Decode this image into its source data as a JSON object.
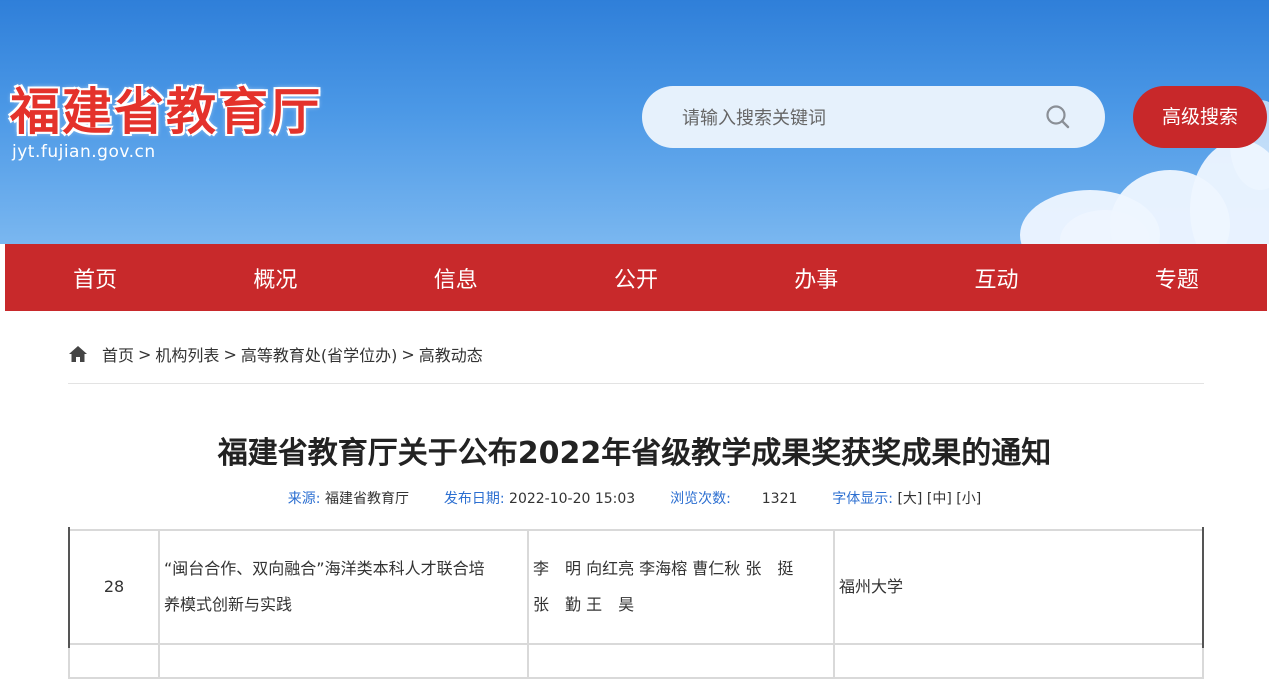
{
  "header": {
    "logo_title": "福建省教育厅",
    "logo_url": "jyt.fujian.gov.cn",
    "search_placeholder": "请输入搜索关键词",
    "advanced_search_label": "高级搜索",
    "colors": {
      "brand_red": "#c8282a",
      "sky_blue": "#3f8fe0"
    }
  },
  "nav": {
    "items": [
      {
        "label": "首页"
      },
      {
        "label": "概况"
      },
      {
        "label": "信息"
      },
      {
        "label": "公开"
      },
      {
        "label": "办事"
      },
      {
        "label": "互动"
      },
      {
        "label": "专题"
      }
    ]
  },
  "breadcrumb": {
    "items": [
      "首页",
      "机构列表",
      "高等教育处(省学位办)",
      "高教动态"
    ],
    "separator": ">",
    "icon": "home-icon"
  },
  "article": {
    "title": "福建省教育厅关于公布2022年省级教学成果奖获奖成果的通知",
    "source_label": "来源:",
    "source_value": "福建省教育厅",
    "date_label": "发布日期:",
    "date_value": "2022-10-20 15:03",
    "views_label": "浏览次数:",
    "views_value": "1321",
    "font_label": "字体显示:",
    "font_large": "[大]",
    "font_medium": "[中]",
    "font_small": "[小]"
  },
  "table": {
    "rows": [
      {
        "no": "28",
        "name_line1": "“闽台合作、双向融合”海洋类本科人才联合培",
        "name_line2": "养模式创新与实践",
        "people_line1": "李　明 向红亮 李海榕 曹仁秋 张　挺",
        "people_line2": "张　勤 王　昊",
        "org": "福州大学"
      }
    ]
  }
}
